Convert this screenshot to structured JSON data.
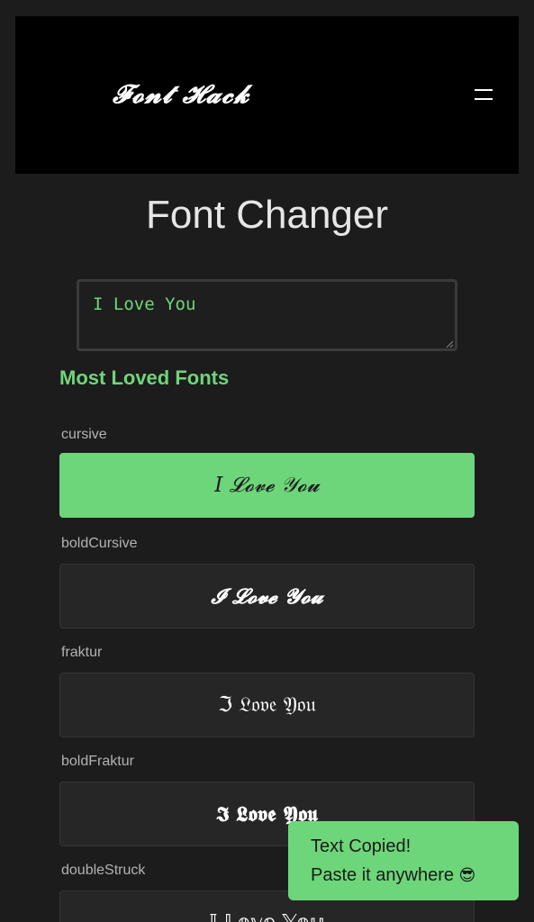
{
  "header": {
    "logo": "𝓕𝓸𝓷𝓽 𝓗𝓪𝓬𝓴",
    "menu_icon": "hamburger-icon"
  },
  "page_title": "Font Changer",
  "input": {
    "value": "I Love You"
  },
  "section_title": "Most Loved Fonts",
  "fonts": [
    {
      "label": "cursive",
      "preview": "𝐼 𝓛𝓸𝓿𝓮 𝒴𝓸𝓾",
      "active": true
    },
    {
      "label": "boldCursive",
      "preview": "𝓘 𝓛𝓸𝓿𝓮 𝓨𝓸𝓾",
      "active": false
    },
    {
      "label": "fraktur",
      "preview": "ℑ 𝔏𝔬𝔳𝔢 𝔜𝔬𝔲",
      "active": false
    },
    {
      "label": "boldFraktur",
      "preview": "𝕴 𝕷𝖔𝖛𝖊 𝖄𝖔𝖚",
      "active": false
    },
    {
      "label": "doubleStruck",
      "preview": "𝕀 𝕃𝕠𝕧𝕖 𝕐𝕠𝕦",
      "active": false
    }
  ],
  "toast": {
    "line1": "Text Copied!",
    "line2": "Paste it anywhere",
    "emoji": "😎"
  },
  "colors": {
    "accent": "#6ed67a",
    "background": "#1c1c1c",
    "header": "#000000",
    "card": "#262626"
  }
}
